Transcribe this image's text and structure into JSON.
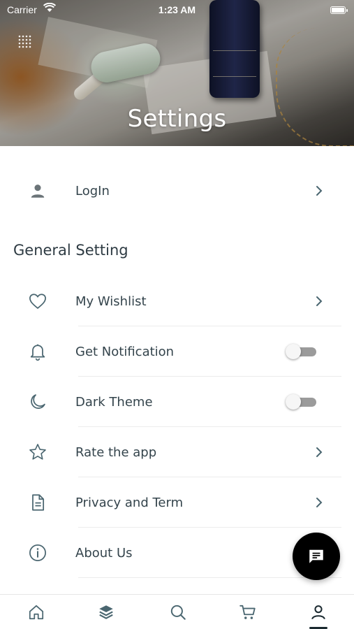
{
  "status_bar": {
    "carrier": "Carrier",
    "time": "1:23 AM"
  },
  "header": {
    "title": "Settings",
    "menu_icon": "grid-dots-icon"
  },
  "account": {
    "login_label": "LogIn",
    "login_icon": "person-icon"
  },
  "general": {
    "section_title": "General Setting",
    "items": [
      {
        "label": "My Wishlist",
        "icon": "heart-icon",
        "control": "chevron"
      },
      {
        "label": "Get Notification",
        "icon": "bell-icon",
        "control": "toggle",
        "on": false
      },
      {
        "label": "Dark Theme",
        "icon": "moon-icon",
        "control": "toggle",
        "on": false
      },
      {
        "label": "Rate the app",
        "icon": "star-icon",
        "control": "chevron"
      },
      {
        "label": "Privacy and Term",
        "icon": "document-icon",
        "control": "chevron"
      },
      {
        "label": "About Us",
        "icon": "info-icon",
        "control": "none"
      }
    ]
  },
  "chat_button": {
    "icon": "chat-icon"
  },
  "tabbar": {
    "tabs": [
      {
        "name": "home",
        "icon": "home-icon"
      },
      {
        "name": "categories",
        "icon": "layers-icon"
      },
      {
        "name": "search",
        "icon": "search-icon"
      },
      {
        "name": "cart",
        "icon": "cart-icon"
      },
      {
        "name": "profile",
        "icon": "user-icon",
        "active": true
      }
    ]
  },
  "colors": {
    "text": "#34444c",
    "icon": "#4a6670",
    "toggle_off_track": "#9b9b9b",
    "fab_background": "#000000",
    "active_tab_underline": "#1b2a30"
  }
}
